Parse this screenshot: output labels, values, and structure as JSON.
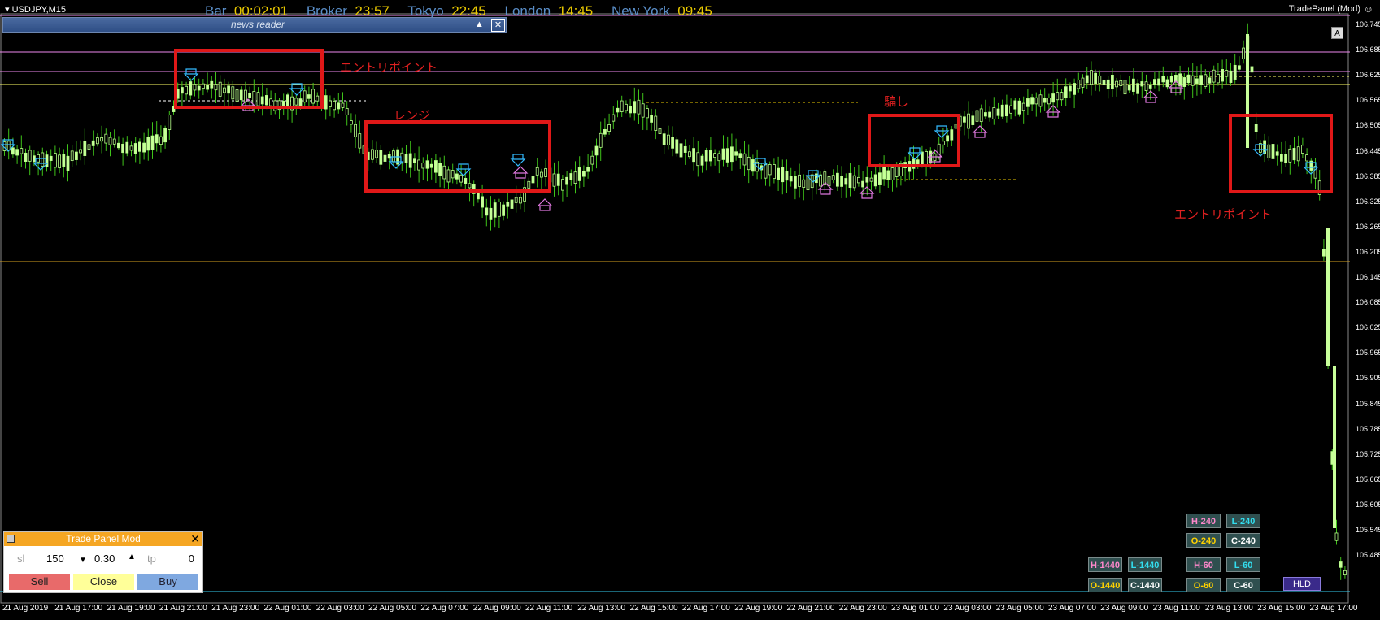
{
  "window": {
    "symbol": "USDJPY,M15",
    "panel_title": "TradePanel (Mod)",
    "panel_icon": "smiley-icon"
  },
  "sessions": [
    {
      "label": "Bar",
      "value": "00:02:01"
    },
    {
      "label": "Broker",
      "value": "23:57"
    },
    {
      "label": "Tokyo",
      "value": "22:45"
    },
    {
      "label": "London",
      "value": "14:45"
    },
    {
      "label": "New York",
      "value": "09:45"
    }
  ],
  "news_reader": {
    "title": "news reader",
    "collapse_icon": "▲",
    "close_icon": "✕"
  },
  "autoscroll_button": "A",
  "price_axis": [
    "106.745",
    "106.685",
    "106.625",
    "106.565",
    "106.505",
    "106.445",
    "106.385",
    "106.325",
    "106.265",
    "106.205",
    "106.145",
    "106.085",
    "106.025",
    "105.965",
    "105.905",
    "105.845",
    "105.785",
    "105.725",
    "105.665",
    "105.605",
    "105.545",
    "105.485"
  ],
  "time_axis": [
    "21 Aug 2019",
    "21 Aug 17:00",
    "21 Aug 19:00",
    "21 Aug 21:00",
    "21 Aug 23:00",
    "22 Aug 01:00",
    "22 Aug 03:00",
    "22 Aug 05:00",
    "22 Aug 07:00",
    "22 Aug 09:00",
    "22 Aug 11:00",
    "22 Aug 13:00",
    "22 Aug 15:00",
    "22 Aug 17:00",
    "22 Aug 19:00",
    "22 Aug 21:00",
    "22 Aug 23:00",
    "23 Aug 01:00",
    "23 Aug 03:00",
    "23 Aug 05:00",
    "23 Aug 07:00",
    "23 Aug 09:00",
    "23 Aug 11:00",
    "23 Aug 13:00",
    "23 Aug 15:00",
    "23 Aug 17:00"
  ],
  "annotations": {
    "entry1": "エントリポイント",
    "range": "レンジ",
    "fake": "騙し",
    "entry2": "エントリポイント"
  },
  "trade_panel": {
    "title": "Trade Panel Mod",
    "close_icon": "✕",
    "sl_label": "sl",
    "sl_value": "150",
    "lot_down": "▼",
    "lot_value": "0.30",
    "lot_up": "▲",
    "tp_label": "tp",
    "tp_value": "0",
    "sell_label": "Sell",
    "close_label": "Close",
    "buy_label": "Buy"
  },
  "level_buttons": {
    "h240": "H-240",
    "l240": "L-240",
    "o240": "O-240",
    "c240": "C-240",
    "h1440": "H-1440",
    "l1440": "L-1440",
    "h60": "H-60",
    "l60": "L-60",
    "o1440": "O-1440",
    "c1440": "C-1440",
    "o60": "O-60",
    "c60": "C-60",
    "hld": "HLD"
  },
  "colors": {
    "candle": "#b8ff8a",
    "wick": "#4cd420",
    "box": "#e02020",
    "sell": "#e86a6a",
    "close": "#ffff99",
    "buy": "#7fa8e0"
  }
}
